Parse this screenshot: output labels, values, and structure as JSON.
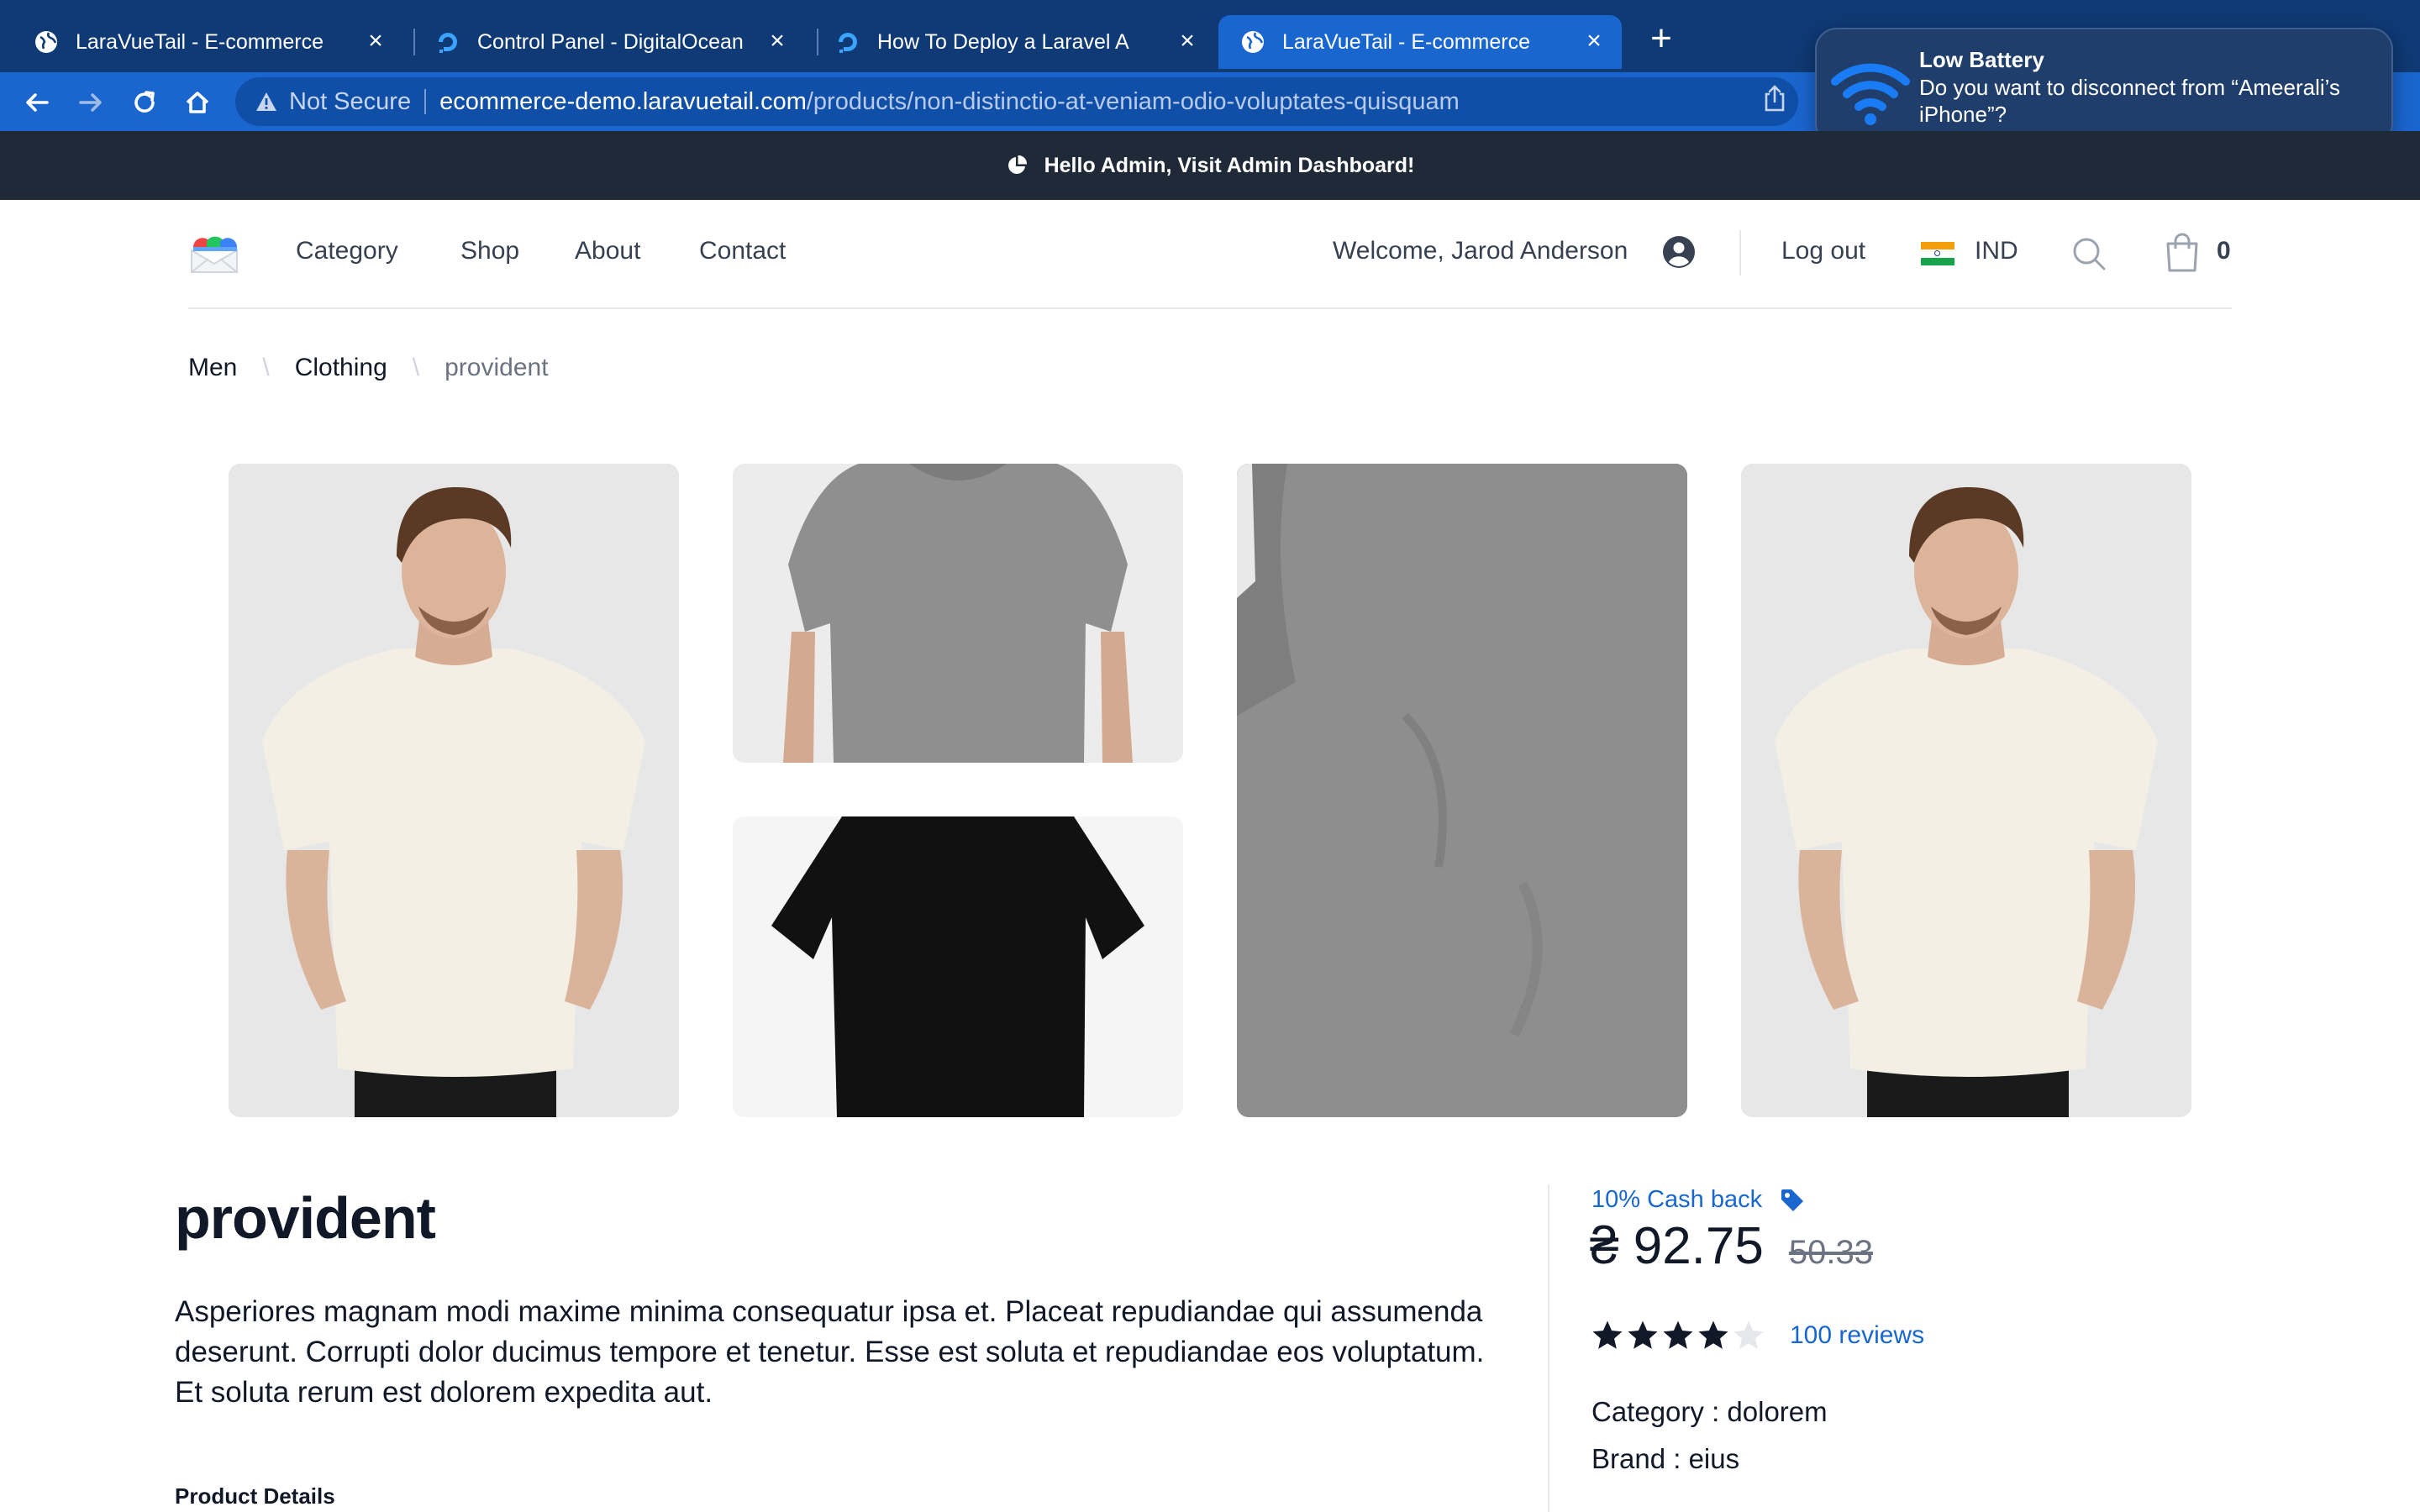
{
  "browser": {
    "tabs": [
      {
        "title": "LaraVueTail - E-commerce",
        "favicon": "globe-icon",
        "active": false
      },
      {
        "title": "Control Panel - DigitalOcean",
        "favicon": "digitalocean-icon",
        "active": false
      },
      {
        "title": "How To Deploy a Laravel Applic",
        "favicon": "digitalocean-icon",
        "active": false
      },
      {
        "title": "LaraVueTail - E-commerce",
        "favicon": "globe-icon",
        "active": true
      }
    ],
    "security_label": "Not Secure",
    "url_host": "ecommerce-demo.laravuetail.com",
    "url_path": "/products/non-distinctio-at-veniam-odio-voluptates-quisquam"
  },
  "notification": {
    "title": "Low Battery",
    "body": "Do you want to disconnect from “Ameerali’s iPhone”?"
  },
  "admin_bar": {
    "text": "Hello Admin, Visit Admin Dashboard!"
  },
  "header": {
    "nav": [
      "Category",
      "Shop",
      "About",
      "Contact"
    ],
    "welcome": "Welcome, Jarod Anderson",
    "logout": "Log out",
    "country": "IND",
    "cart_count": "0"
  },
  "breadcrumb": [
    "Men",
    "Clothing",
    "provident"
  ],
  "product": {
    "title": "provident",
    "description": "Asperiores magnam modi maxime minima consequatur ipsa et. Placeat repudiandae qui assumenda deserunt. Corrupti dolor ducimus tempore et tenetur. Esse est soluta et repudiandae eos voluptatum. Et soluta rerum est dolorem expedita aut.",
    "details_heading": "Product Details",
    "cashback": "10% Cash back",
    "price": "₴ 92.75",
    "old_price": "50.33",
    "rating": 4,
    "rating_max": 5,
    "reviews": "100 reviews",
    "category": "Category : dolorem",
    "brand": "Brand : eius"
  },
  "colors": {
    "tabbar": "#0f3a75",
    "toolbar": "#1a66cf",
    "admin_bar": "#1f2937",
    "link": "#1a66cf"
  }
}
